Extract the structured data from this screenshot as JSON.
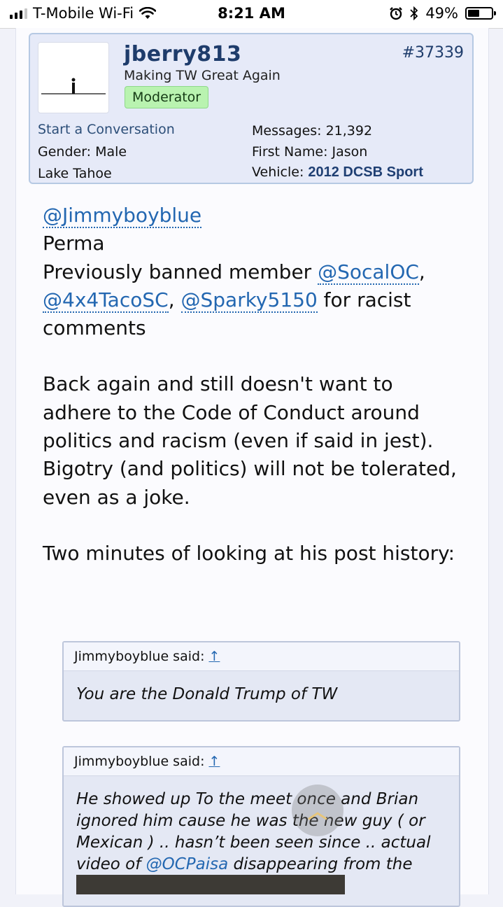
{
  "status_bar": {
    "carrier": "T-Mobile Wi-Fi",
    "time": "8:21 AM",
    "battery_percent": "49%",
    "battery_level": 0.49,
    "icons": [
      "signal-icon",
      "wifi-icon",
      "alarm-icon",
      "bluetooth-icon",
      "battery-icon"
    ]
  },
  "post": {
    "username": "jberry813",
    "user_title": "Making TW Great Again",
    "role_badge": "Moderator",
    "post_number": "#37339",
    "start_conversation": "Start a Conversation",
    "gender_label": "Gender:",
    "gender": "Male",
    "location": "Lake Tahoe",
    "messages_label": "Messages:",
    "messages": "21,392",
    "first_name_label": "First Name:",
    "first_name": "Jason",
    "vehicle_label": "Vehicle:",
    "vehicle": "2012 DCSB Sport"
  },
  "body": {
    "mention_jimmy": "@Jimmyboyblue",
    "line_perma": "Perma",
    "line_prev": "Previously banned member ",
    "mention_socal": "@SocalOC",
    "comma1": ",",
    "mention_taco": "@4x4TacoSC",
    "comma2": ", ",
    "mention_sparky": "@Sparky5150",
    "line_racist": " for racist comments",
    "paragraph2": "Back again and still doesn't want to adhere to the Code of Conduct around politics and racism (even if said in jest). Bigotry (and politics) will not be tolerated, even as a joke.",
    "paragraph3": "Two minutes of looking at his post history:"
  },
  "quotes": [
    {
      "author_said": "Jimmyboyblue said:",
      "arrow": "↑",
      "text": "You are the Donald Trump of TW"
    },
    {
      "author_said": "Jimmyboyblue said:",
      "arrow": "↑",
      "text_before": "He showed up To the meet once and Brian ignored him cause he was the new guy ( or Mexican ) .. hasn’t been seen since .. actual video of ",
      "mention": "@OCPaisa",
      "text_after": " disappearing from the"
    }
  ],
  "scroll_top_icon": "chevron-up-icon",
  "colors": {
    "link": "#2367b1",
    "username": "#1e3c6b",
    "badge_bg": "#b9f3b0",
    "userbox_bg": "#e6eaf8",
    "quote_bg": "#e4e8f4"
  }
}
